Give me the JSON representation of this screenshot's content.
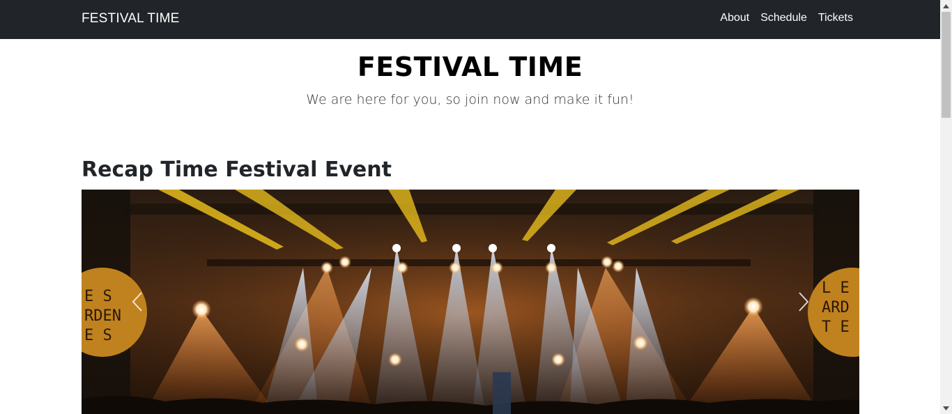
{
  "navbar": {
    "brand": "FESTIVAL TIME",
    "links": [
      "About",
      "Schedule",
      "Tickets"
    ]
  },
  "hero": {
    "title": "FESTIVAL TIME",
    "subtitle": "We are here for you, so join now and make it fun!"
  },
  "recap": {
    "title": "Recap Time Festival Event"
  },
  "carousel": {
    "image": "concert-stage-lights",
    "prev_icon": "chevron-left-icon",
    "next_icon": "chevron-right-icon",
    "sign_left_text": [
      "E S",
      "RDEN",
      "E S"
    ],
    "sign_right_text": [
      "L E",
      "ARD",
      "T E"
    ]
  },
  "colors": {
    "navbar_bg": "#212529",
    "beam_orange": "#f39a3a",
    "beam_yellow": "#ffd21f",
    "beam_blue": "#bcd9ff"
  }
}
